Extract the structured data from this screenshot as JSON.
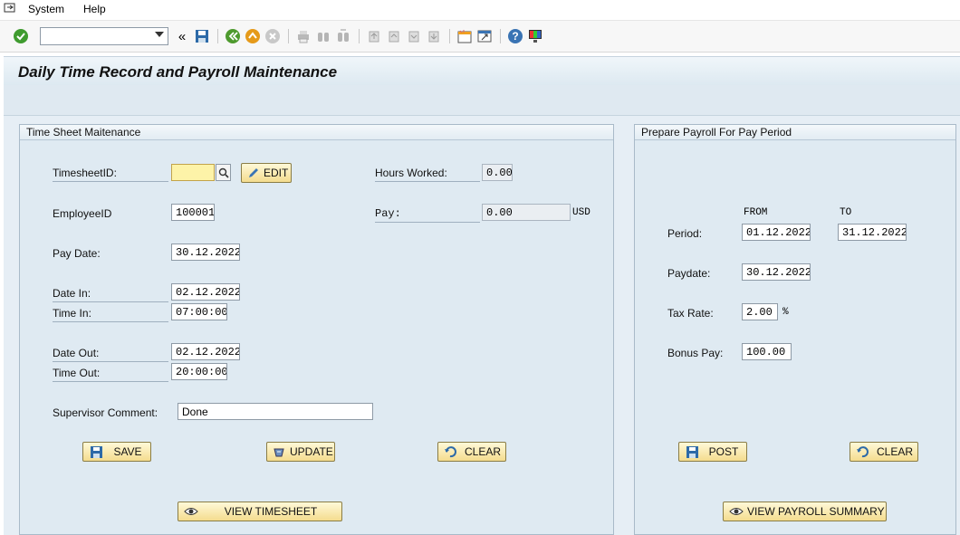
{
  "menu": {
    "system": "System",
    "help": "Help"
  },
  "toolbar": {
    "command_value": ""
  },
  "title": "Daily Time Record and Payroll Maintenance",
  "timesheet": {
    "group_title": "Time Sheet Maitenance",
    "timesheet_id_label": "TimesheetID:",
    "timesheet_id_value": "",
    "edit_label": "EDIT",
    "hours_label": "Hours Worked:",
    "hours_value": "0.00",
    "employee_label": "EmployeeID",
    "employee_value": "100001",
    "pay_label": "Pay:",
    "pay_value": "0.00",
    "pay_unit": "USD",
    "pay_date_label": "Pay Date:",
    "pay_date_value": "30.12.2022",
    "date_in_label": "Date In:",
    "date_in_value": "02.12.2022",
    "time_in_label": "Time In:",
    "time_in_value": "07:00:00",
    "date_out_label": "Date Out:",
    "date_out_value": "02.12.2022",
    "time_out_label": "Time Out:",
    "time_out_value": "20:00:00",
    "comment_label": "Supervisor Comment:",
    "comment_value": "Done",
    "save_label": "SAVE",
    "update_label": "UPDATE",
    "clear_label": "CLEAR",
    "view_label": "VIEW TIMESHEET"
  },
  "payroll": {
    "group_title": "Prepare Payroll For Pay Period",
    "from_label": "FROM",
    "to_label": "TO",
    "period_label": "Period:",
    "period_from": "01.12.2022",
    "period_to": "31.12.2022",
    "paydate_label": "Paydate:",
    "paydate_value": "30.12.2022",
    "tax_label": "Tax Rate:",
    "tax_value": "2.00",
    "tax_unit": "%",
    "bonus_label": "Bonus Pay:",
    "bonus_value": "100.00",
    "post_label": "POST",
    "clear_label": "CLEAR",
    "view_label": "VIEW PAYROLL SUMMARY"
  },
  "colors": {
    "accent_button": "#f4dc8e",
    "background": "#dfeaf2",
    "required_field": "#fdf3a8"
  }
}
